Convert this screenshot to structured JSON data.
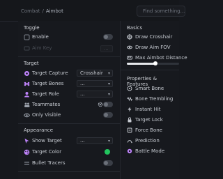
{
  "breadcrumb": {
    "parent": "Combat",
    "separator": "/",
    "current": "Aimbot"
  },
  "search": {
    "placeholder": "Find something..."
  },
  "left": {
    "toggle": {
      "title": "Toggle",
      "enable": {
        "label": "Enable"
      },
      "aim_key": {
        "label": "Aim Key",
        "value": "..."
      }
    },
    "target": {
      "title": "Target",
      "capture": {
        "label": "Target Capture",
        "value": "Crosshair"
      },
      "bones": {
        "label": "Target Bones",
        "value": "..."
      },
      "role": {
        "label": "Target Role",
        "value": "..."
      },
      "teammates": {
        "label": "Teammates"
      },
      "only_visible": {
        "label": "Only Visible"
      }
    },
    "appearance": {
      "title": "Appearance",
      "show_target": {
        "label": "Show Target",
        "value": "..."
      },
      "target_color": {
        "label": "Target Color",
        "color": "#22c55e"
      },
      "bullet_tracers": {
        "label": "Bullet Tracers"
      }
    }
  },
  "right": {
    "basics": {
      "title": "Basics",
      "items": [
        {
          "label": "Draw Crosshair"
        },
        {
          "label": "Draw Aim FOV"
        },
        {
          "label": "Max Aimbot Distance"
        }
      ],
      "distance_level": 0.55
    },
    "features": {
      "title": "Properties & Features",
      "items": [
        {
          "label": "Smart Bone"
        },
        {
          "label": "Bone Trembling"
        },
        {
          "label": "Instant Hit"
        },
        {
          "label": "Target Lock"
        },
        {
          "label": "Force Bone"
        },
        {
          "label": "Prediction"
        },
        {
          "label": "Battle Mode"
        }
      ]
    }
  },
  "colors": {
    "accent": "#c084fc",
    "success": "#22c55e"
  }
}
